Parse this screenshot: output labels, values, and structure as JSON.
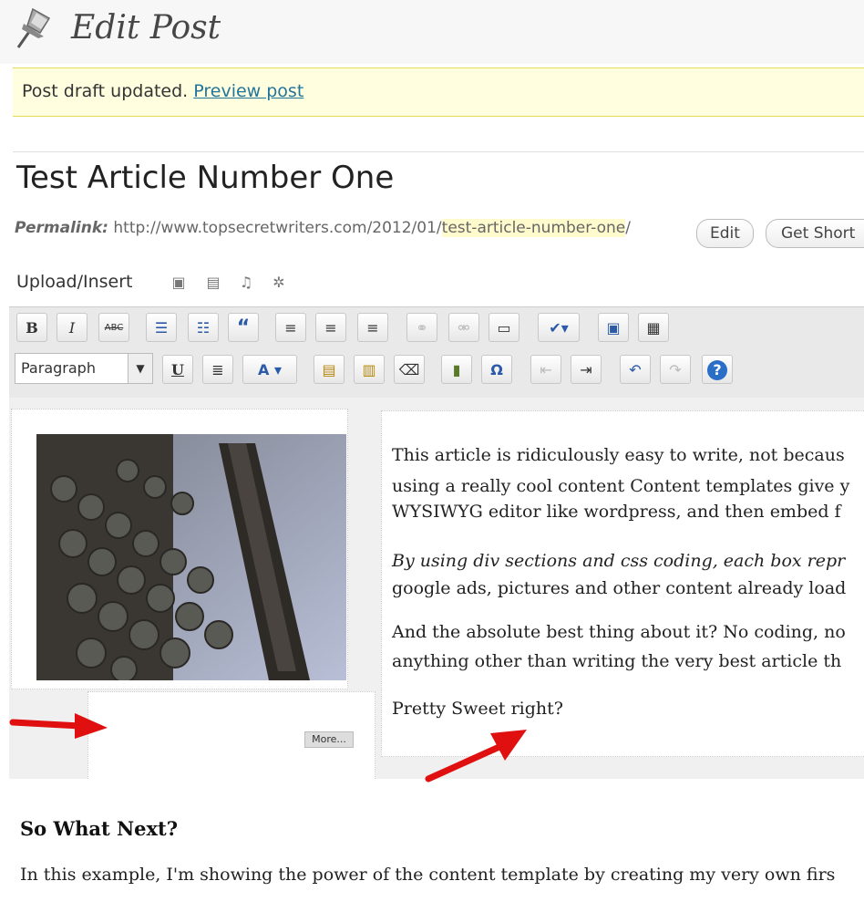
{
  "header": {
    "title": "Edit Post"
  },
  "notice": {
    "text": "Post draft updated.",
    "link": "Preview post"
  },
  "post": {
    "title": "Test Article Number One"
  },
  "permalink": {
    "label": "Permalink:",
    "base": "http://www.topsecretwriters.com/2012/01/",
    "slug": "test-article-number-one",
    "trailing": "/",
    "edit_button": "Edit",
    "shortlink_button": "Get Short"
  },
  "upload": {
    "label": "Upload/Insert"
  },
  "toolbar": {
    "bold": "B",
    "italic": "I",
    "strike": "ABC",
    "format_select": "Paragraph",
    "underline": "U",
    "text_color": "A"
  },
  "content": {
    "more_label": "More...",
    "paragraphs": [
      "This article is ridiculously easy to write, not becaus",
      "using a really cool content Content templates give y",
      "WYSIWYG editor like wordpress, and then embed f",
      "By using div sections and css coding, each box repr",
      "google ads, pictures and other content already load",
      "And the absolute best thing about it? No coding, no",
      "anything other than writing the very best article th",
      "Pretty Sweet right?"
    ],
    "heading": "So What Next?",
    "bottom_paragraph": "In this example, I'm showing the power of the content template by creating my very own firs"
  }
}
